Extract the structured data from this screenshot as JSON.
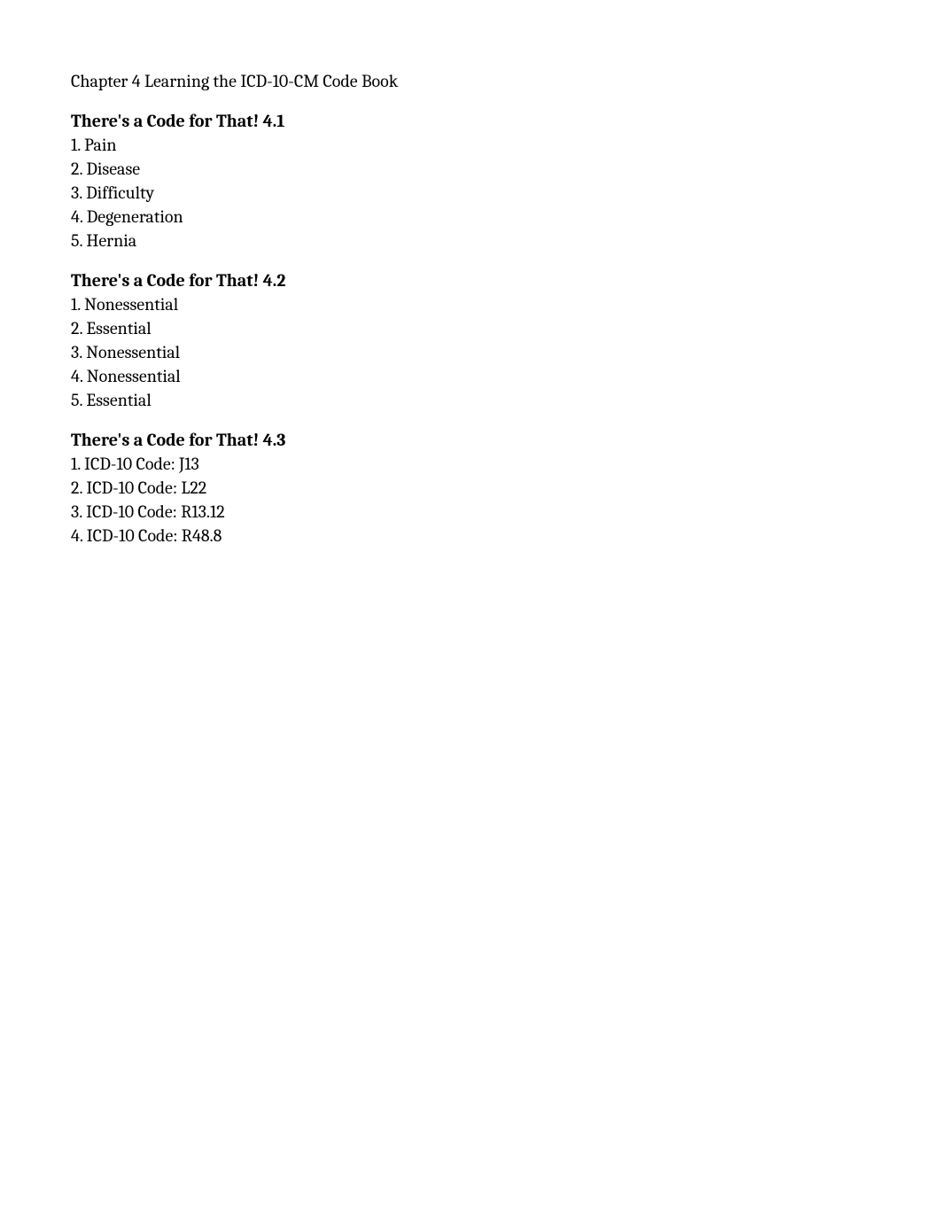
{
  "chapter_title": "Chapter 4 Learning the ICD-10-CM Code Book",
  "sections": [
    {
      "heading": "There's a Code for That! 4.1",
      "items": [
        "1. Pain",
        "2. Disease",
        "3. Difficulty",
        "4. Degeneration",
        "5. Hernia"
      ]
    },
    {
      "heading": "There's a Code for That! 4.2",
      "items": [
        "1. Nonessential",
        "2. Essential",
        "3. Nonessential",
        "4. Nonessential",
        "5. Essential"
      ]
    },
    {
      "heading": "There's a Code for That! 4.3",
      "items": [
        "1. ICD-10 Code: J13",
        "2. ICD-10 Code: L22",
        "3. ICD-10 Code: R13.12",
        "4. ICD-10 Code: R48.8"
      ]
    }
  ]
}
